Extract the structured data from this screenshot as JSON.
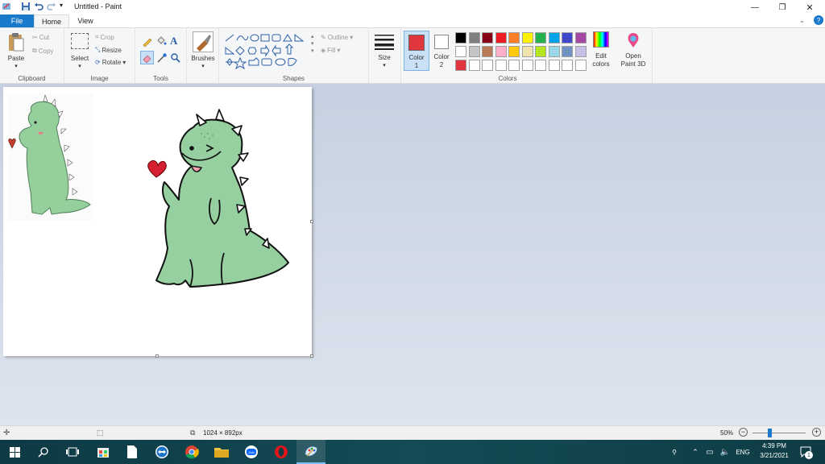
{
  "window": {
    "title": "Untitled - Paint",
    "controls": {
      "minimize": "—",
      "restore": "❐",
      "close": "✕"
    }
  },
  "tabs": {
    "file": "File",
    "home": "Home",
    "view": "View"
  },
  "ribbon": {
    "clipboard": {
      "group": "Clipboard",
      "paste": "Paste",
      "cut": "Cut",
      "copy": "Copy"
    },
    "image": {
      "group": "Image",
      "select": "Select",
      "crop": "Crop",
      "resize": "Resize",
      "rotate": "Rotate"
    },
    "tools": {
      "group": "Tools"
    },
    "brushes": {
      "label": "Brushes"
    },
    "shapes": {
      "group": "Shapes",
      "outline": "Outline",
      "fill": "Fill"
    },
    "size": {
      "label": "Size"
    },
    "colors": {
      "group": "Colors",
      "color1": "Color",
      "color1_num": "1",
      "color2": "Color",
      "color2_num": "2",
      "color1_value": "#e0373f",
      "color2_value": "#ffffff",
      "edit_colors_1": "Edit",
      "edit_colors_2": "colors",
      "palette_row1": [
        "#000000",
        "#7f7f7f",
        "#880015",
        "#ed1c24",
        "#ff7f27",
        "#fff200",
        "#22b14c",
        "#00a2e8",
        "#3f48cc",
        "#a349a4"
      ],
      "palette_row2": [
        "#ffffff",
        "#c3c3c3",
        "#b97a57",
        "#ffaec9",
        "#ffc90e",
        "#efe4b0",
        "#b5e61d",
        "#99d9ea",
        "#7092be",
        "#c8bfe7"
      ],
      "palette_row3": [
        "#e0373f",
        "#ffffff",
        "#ffffff",
        "#ffffff",
        "#ffffff",
        "#ffffff",
        "#ffffff",
        "#ffffff",
        "#ffffff",
        "#ffffff"
      ]
    },
    "paint3d": {
      "label1": "Open",
      "label2": "Paint 3D"
    }
  },
  "canvas": {
    "dino_color": "#96cfa0"
  },
  "status": {
    "image_size": "1024 × 892px",
    "zoom": "50%",
    "zoom_level": 0.5
  },
  "taskbar": {
    "language": "ENG",
    "time": "4:39 PM",
    "date": "3/21/2021",
    "notification_count": "1"
  }
}
